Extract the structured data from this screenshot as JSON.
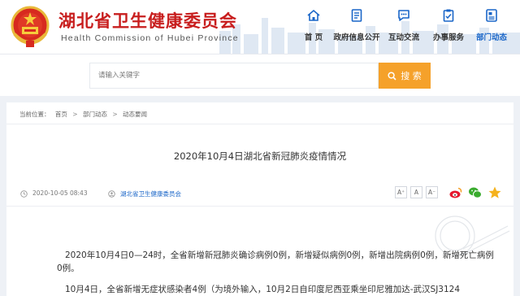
{
  "header": {
    "title": "湖北省卫生健康委员会",
    "subtitle": "Health Commission of Hubei Province"
  },
  "nav": [
    {
      "label": "首  页",
      "icon": "home-icon",
      "active": false
    },
    {
      "label": "政府信息公开",
      "icon": "document-icon",
      "active": false
    },
    {
      "label": "互动交流",
      "icon": "chat-icon",
      "active": false
    },
    {
      "label": "办事服务",
      "icon": "clipboard-icon",
      "active": false
    },
    {
      "label": "部门动态",
      "icon": "news-icon",
      "active": true
    }
  ],
  "search": {
    "placeholder": "请输入关键字",
    "button_label": "搜 索",
    "accent": "#f5a12a"
  },
  "breadcrumb": [
    "当前位置：",
    "首页",
    "部门动态",
    "动态要闻"
  ],
  "article": {
    "title": "2020年10月4日湖北省新冠肺炎疫情情况",
    "date": "2020-10-05 08:43",
    "source": "湖北省卫生健康委员会",
    "font_buttons": [
      "A⁺",
      "A",
      "A⁻"
    ],
    "paragraphs": [
      "2020年10月4日0—24时，全省新增新冠肺炎确诊病例0例，新增疑似病例0例，新增出院病例0例，新增死亡病例0例。",
      "10月4日，全省新增无症状感染者4例（为境外输入，10月2日自印度尼西亚乘坐印尼雅加达-武汉SJ3124"
    ]
  },
  "colors": {
    "brand_red": "#c81e1e",
    "link_blue": "#1a66c8"
  }
}
